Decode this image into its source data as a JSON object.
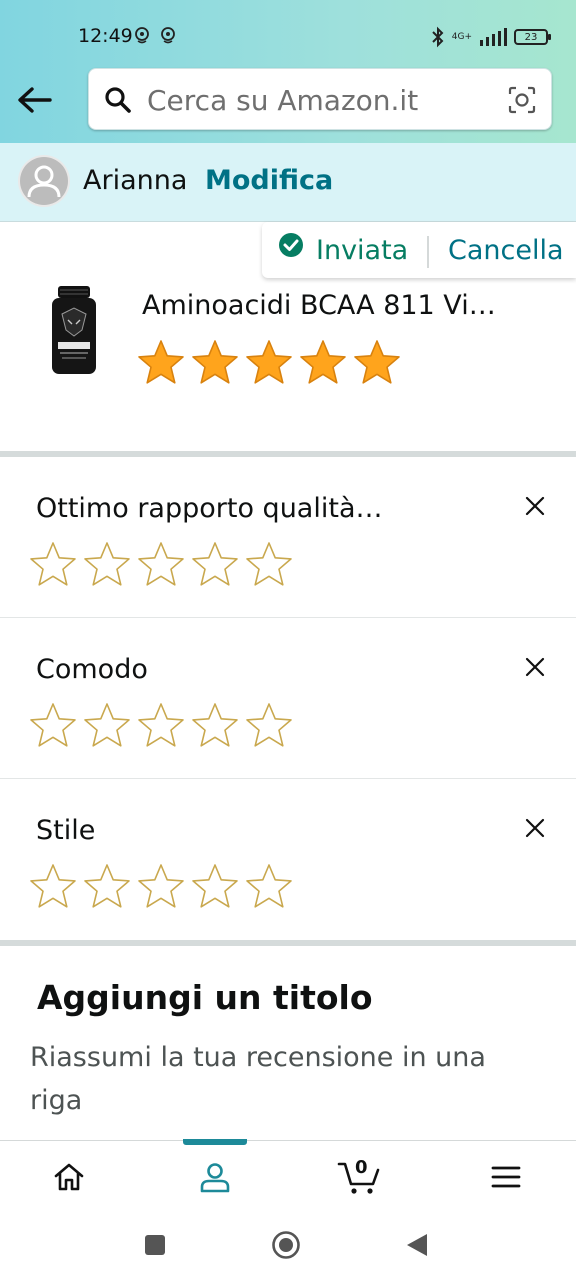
{
  "status_bar": {
    "time": "12:49",
    "network": "4G+",
    "battery": "23"
  },
  "search": {
    "placeholder": "Cerca su Amazon.it"
  },
  "profile": {
    "name": "Arianna",
    "edit_label": "Modifica"
  },
  "product": {
    "status_label": "Inviata",
    "cancel_label": "Cancella",
    "title": "Aminoacidi BCAA 811 Vi…",
    "rating": 5,
    "rating_max": 5
  },
  "attributes": [
    {
      "title": "Ottimo rapporto qualità…",
      "rating": 0
    },
    {
      "title": "Comodo",
      "rating": 0
    },
    {
      "title": "Stile",
      "rating": 0
    }
  ],
  "title_section": {
    "heading": "Aggiungi un titolo",
    "hint": "Riassumi la tua recensione in una riga"
  },
  "bottom_nav": {
    "cart_count": "0",
    "active_tab": "profile"
  },
  "colors": {
    "accent": "#007185",
    "success": "#067d62",
    "star_fill": "#ffa41c",
    "star_outline": "#c9a84e"
  }
}
